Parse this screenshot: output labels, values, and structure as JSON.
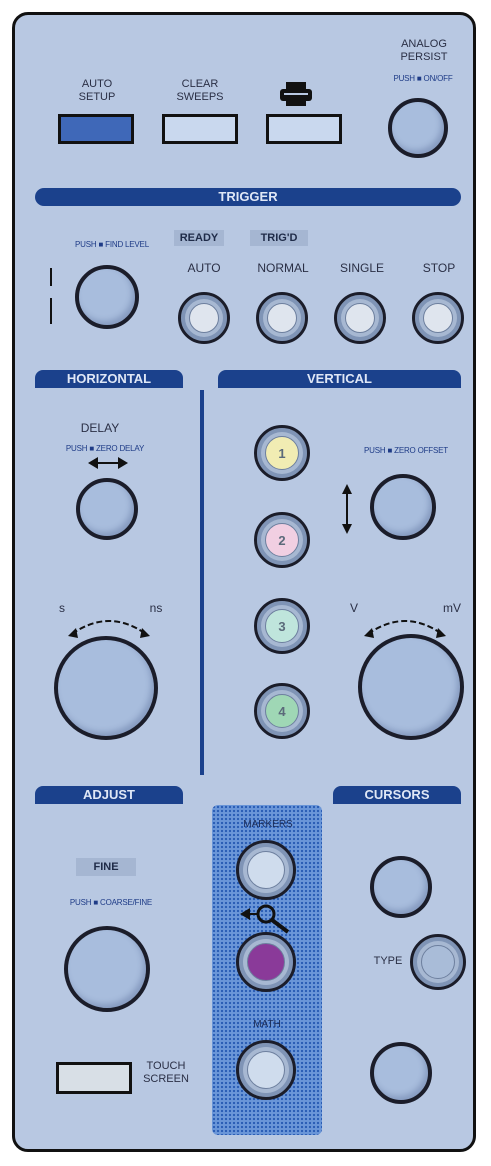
{
  "top": {
    "auto_setup": "AUTO\nSETUP",
    "clear_sweeps": "CLEAR\nSWEEPS",
    "print_icon": "printer-icon",
    "analog_persist": "ANALOG\nPERSIST",
    "push_on_off": "PUSH ■ ON/OFF"
  },
  "trigger": {
    "title": "TRIGGER",
    "push_find_level": "PUSH ■ FIND LEVEL",
    "ready": "READY",
    "trigd": "TRIG'D",
    "buttons": [
      "AUTO",
      "NORMAL",
      "SINGLE",
      "STOP"
    ]
  },
  "horizontal": {
    "title": "HORIZONTAL",
    "delay": "DELAY",
    "push_zero_delay": "PUSH ■ ZERO DELAY",
    "s_label": "s",
    "ns_label": "ns"
  },
  "vertical": {
    "title": "VERTICAL",
    "channels": [
      "1",
      "2",
      "3",
      "4"
    ],
    "push_zero_offset": "PUSH ■ ZERO OFFSET",
    "v_label": "V",
    "mv_label": "mV"
  },
  "adjust": {
    "title": "ADJUST",
    "fine": "FINE",
    "push_coarse_fine": "PUSH ■ COARSE/FINE",
    "touch_screen": "TOUCH\nSCREEN"
  },
  "center": {
    "markers": "MARKERS",
    "zoom_icon": "zoom-magnifier-icon",
    "math": "MATH"
  },
  "cursors": {
    "title": "CURSORS",
    "type": "TYPE"
  },
  "colors": {
    "panel": "#b8c8e2",
    "header": "#1b418c",
    "auto_setup_button": "#3f68b8",
    "ch1": "#f1ecb3",
    "ch2": "#f1cfe2",
    "ch3": "#bfe5dc",
    "ch4": "#9fd7b5",
    "zoom_button": "#8a3a99"
  }
}
